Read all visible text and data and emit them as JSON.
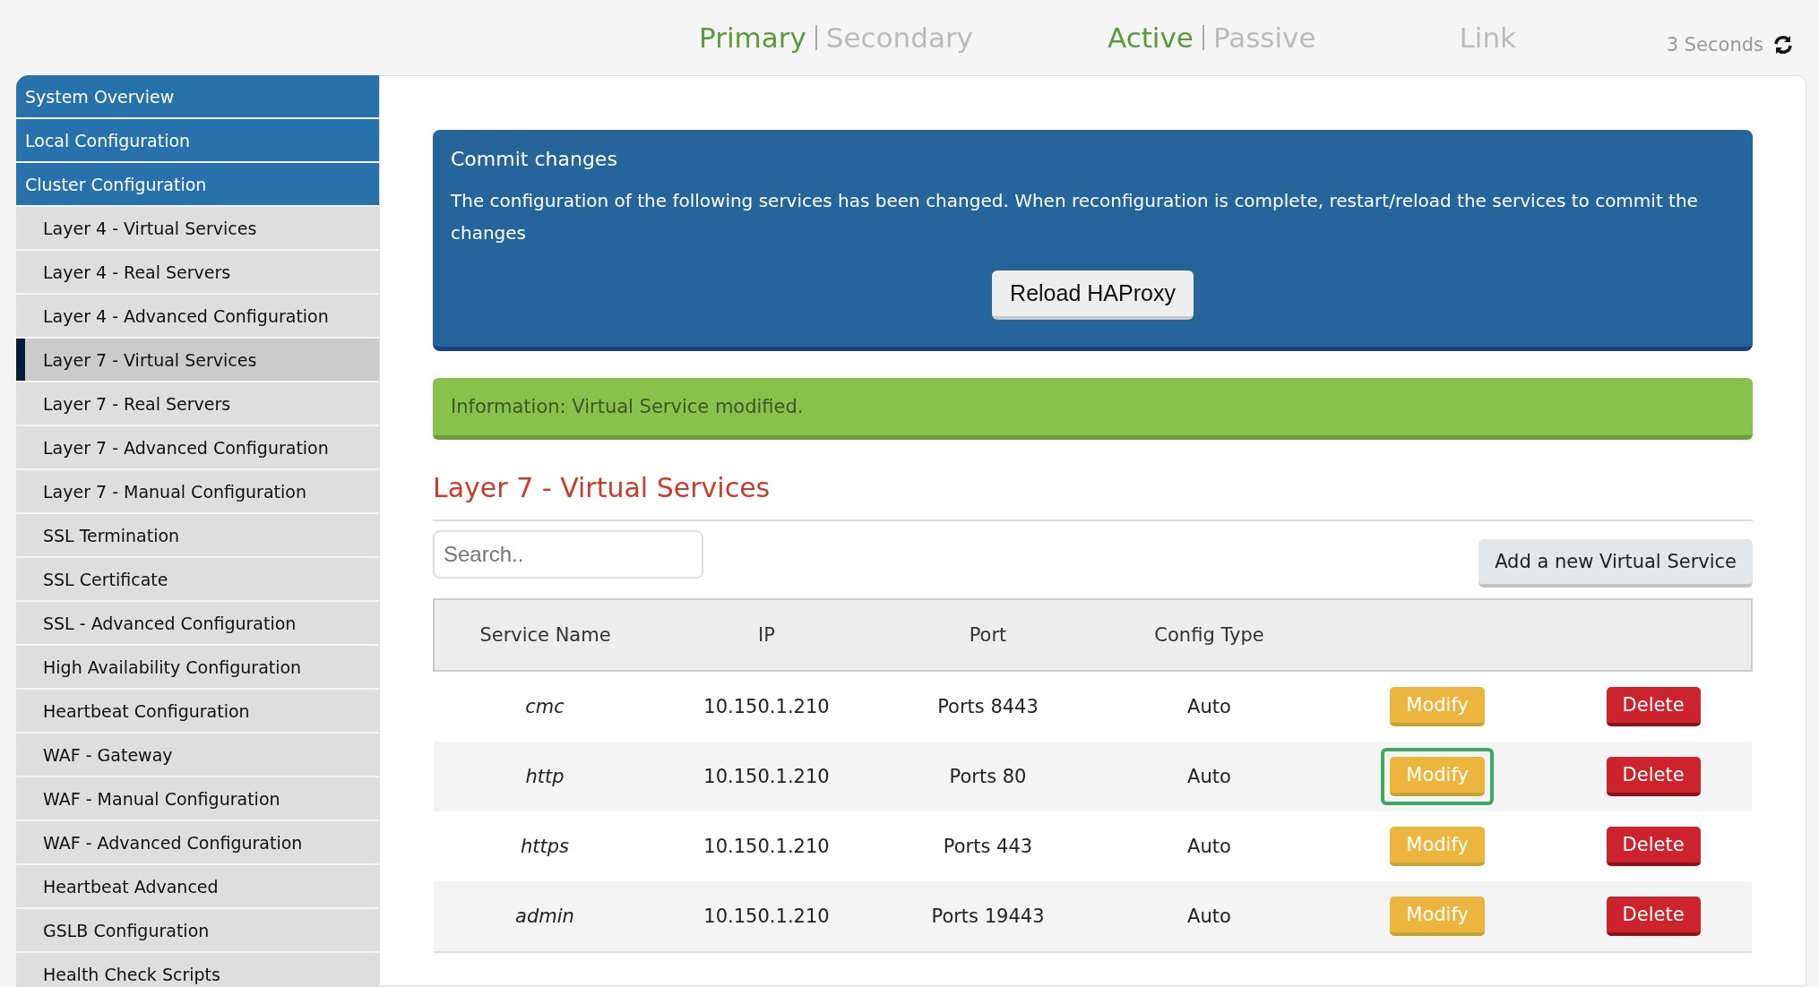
{
  "top_nav": {
    "groups": [
      {
        "kind": "pair",
        "items": [
          {
            "label": "Primary",
            "selected": true
          },
          {
            "label": "Secondary",
            "selected": false
          }
        ]
      },
      {
        "kind": "pair",
        "items": [
          {
            "label": "Active",
            "selected": true
          },
          {
            "label": "Passive",
            "selected": false
          }
        ]
      },
      {
        "kind": "single",
        "items": [
          {
            "label": "Link",
            "selected": false
          }
        ]
      }
    ],
    "refresh": "3 Seconds"
  },
  "sidebar": {
    "items": [
      {
        "label": "System Overview",
        "kind": "section",
        "selected": false
      },
      {
        "label": "Local Configuration",
        "kind": "section",
        "selected": false
      },
      {
        "label": "Cluster Configuration",
        "kind": "section",
        "selected": false
      },
      {
        "label": "Layer 4 - Virtual Services",
        "kind": "sub",
        "selected": false
      },
      {
        "label": "Layer 4 - Real Servers",
        "kind": "sub",
        "selected": false
      },
      {
        "label": "Layer 4 - Advanced Configuration",
        "kind": "sub",
        "selected": false
      },
      {
        "label": "Layer 7 - Virtual Services",
        "kind": "sub",
        "selected": true
      },
      {
        "label": "Layer 7 - Real Servers",
        "kind": "sub",
        "selected": false
      },
      {
        "label": "Layer 7 - Advanced Configuration",
        "kind": "sub",
        "selected": false
      },
      {
        "label": "Layer 7 - Manual Configuration",
        "kind": "sub",
        "selected": false
      },
      {
        "label": "SSL Termination",
        "kind": "sub",
        "selected": false
      },
      {
        "label": "SSL Certificate",
        "kind": "sub",
        "selected": false
      },
      {
        "label": "SSL - Advanced Configuration",
        "kind": "sub",
        "selected": false
      },
      {
        "label": "High Availability Configuration",
        "kind": "sub",
        "selected": false
      },
      {
        "label": "Heartbeat Configuration",
        "kind": "sub",
        "selected": false
      },
      {
        "label": "WAF - Gateway",
        "kind": "sub",
        "selected": false
      },
      {
        "label": "WAF - Manual Configuration",
        "kind": "sub",
        "selected": false
      },
      {
        "label": "WAF - Advanced Configuration",
        "kind": "sub",
        "selected": false
      },
      {
        "label": "Heartbeat Advanced",
        "kind": "sub",
        "selected": false
      },
      {
        "label": "GSLB Configuration",
        "kind": "sub",
        "selected": false
      },
      {
        "label": "Health Check Scripts",
        "kind": "sub",
        "selected": false
      }
    ]
  },
  "commit_panel": {
    "title": "Commit changes",
    "message": "The configuration of the following services has been changed. When reconfiguration is complete, restart/reload the services to commit the changes",
    "button": "Reload HAProxy"
  },
  "info_message": "Information: Virtual Service modified.",
  "heading": "Layer 7 - Virtual Services",
  "search": {
    "placeholder": "Search.."
  },
  "add_button": "Add a new Virtual Service",
  "table": {
    "columns": [
      "Service Name",
      "IP",
      "Port",
      "Config Type"
    ],
    "rows": [
      {
        "cells": [
          "cmc",
          "10.150.1.210",
          "Ports 8443",
          "Auto"
        ],
        "modify": "Modify",
        "delete": "Delete",
        "highlighted": false
      },
      {
        "cells": [
          "http",
          "10.150.1.210",
          "Ports 80",
          "Auto"
        ],
        "modify": "Modify",
        "delete": "Delete",
        "highlighted": true
      },
      {
        "cells": [
          "https",
          "10.150.1.210",
          "Ports 443",
          "Auto"
        ],
        "modify": "Modify",
        "delete": "Delete",
        "highlighted": false
      },
      {
        "cells": [
          "admin",
          "10.150.1.210",
          "Ports 19443",
          "Auto"
        ],
        "modify": "Modify",
        "delete": "Delete",
        "highlighted": false
      }
    ]
  }
}
